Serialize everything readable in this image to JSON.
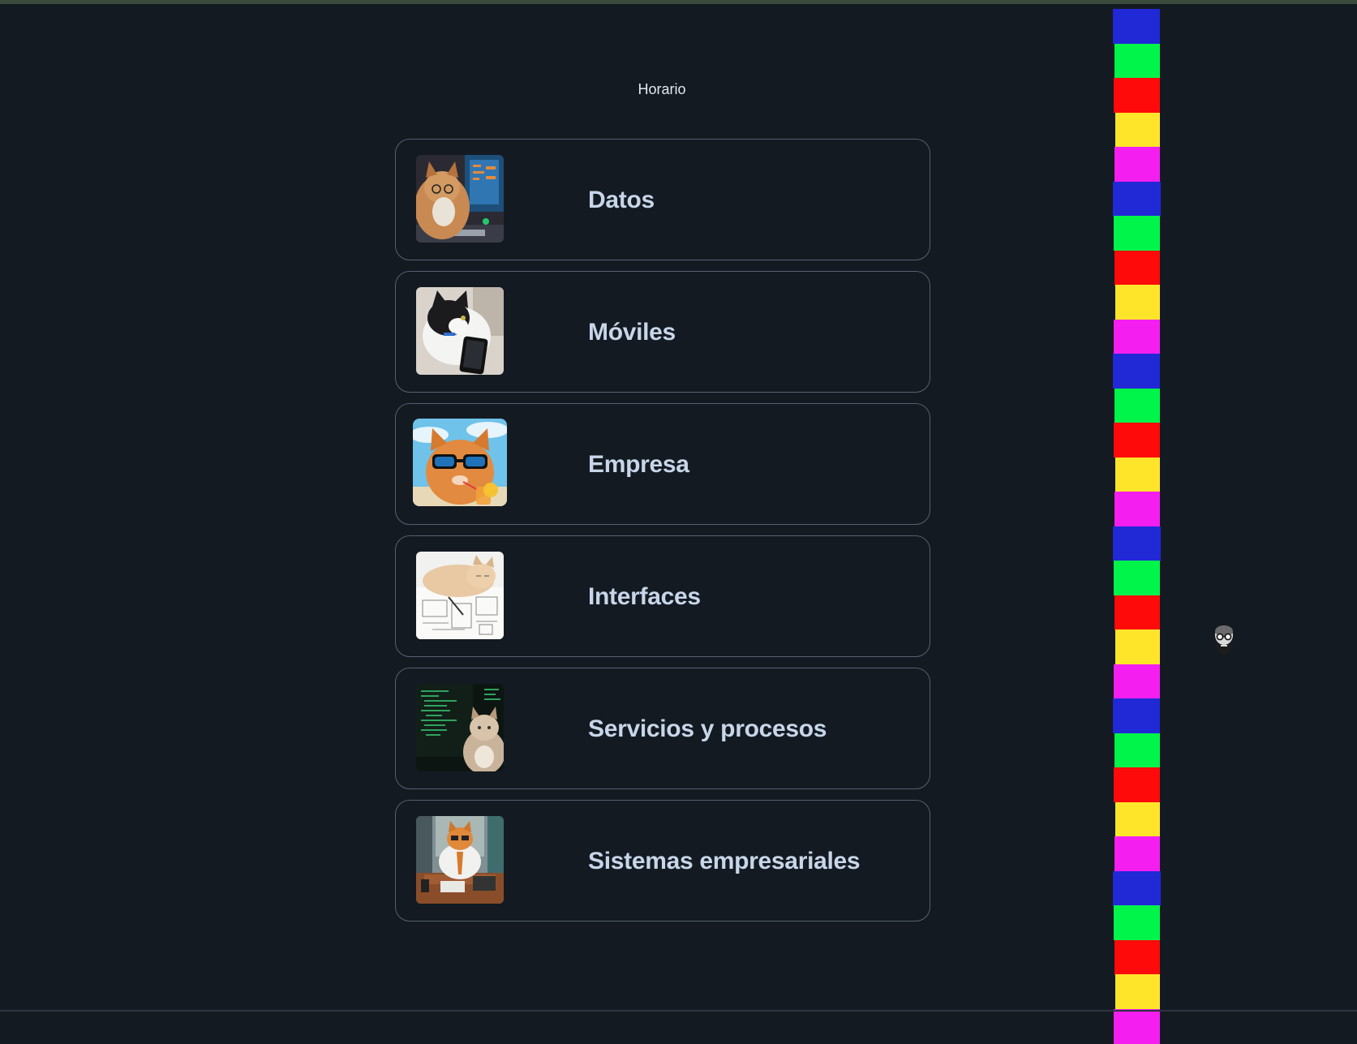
{
  "header": {
    "title": "Horario"
  },
  "courses": [
    {
      "label": "Datos",
      "image": "cat-with-glasses-at-computer"
    },
    {
      "label": "Móviles",
      "image": "cat-with-smartphone"
    },
    {
      "label": "Empresa",
      "image": "cat-with-sunglasses-and-drink"
    },
    {
      "label": "Interfaces",
      "image": "cat-sleeping-on-blueprints"
    },
    {
      "label": "Servicios y procesos",
      "image": "cat-by-code-screen"
    },
    {
      "label": "Sistemas empresariales",
      "image": "cat-in-business-suit-at-desk"
    }
  ],
  "color_column": {
    "palette": [
      "#2128d6",
      "#00f54a",
      "#ff0a0a",
      "#ffe52a",
      "#f51ef0"
    ]
  },
  "avatar": {
    "icon": "bearded-man-avatar-icon"
  },
  "colors": {
    "background": "#141a22",
    "card_border": "#56606d",
    "label_text": "#c7d6e8",
    "title_text": "#e3e8ee"
  }
}
